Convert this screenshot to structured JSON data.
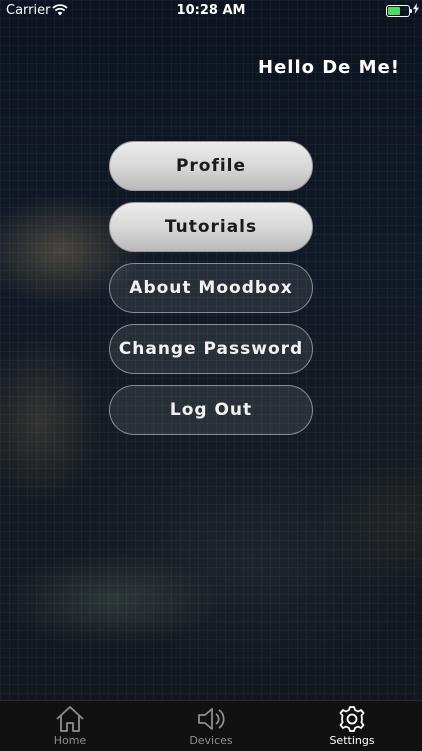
{
  "status_bar": {
    "carrier": "Carrier",
    "time": "10:28 AM",
    "battery_level": 0.6
  },
  "greeting": "Hello De Me!",
  "menu": {
    "profile": "Profile",
    "tutorials": "Tutorials",
    "about": "About Moodbox",
    "change_password": "Change Password",
    "logout": "Log Out"
  },
  "tabs": {
    "home": "Home",
    "devices": "Devices",
    "settings": "Settings",
    "active": "settings"
  },
  "colors": {
    "battery": "#4cd964",
    "active_tab": "#ffffff",
    "inactive_tab": "#8e8e8e"
  },
  "icons": [
    "wifi-icon",
    "battery-icon",
    "charging-bolt-icon",
    "home-icon",
    "speaker-icon",
    "gear-icon"
  ]
}
